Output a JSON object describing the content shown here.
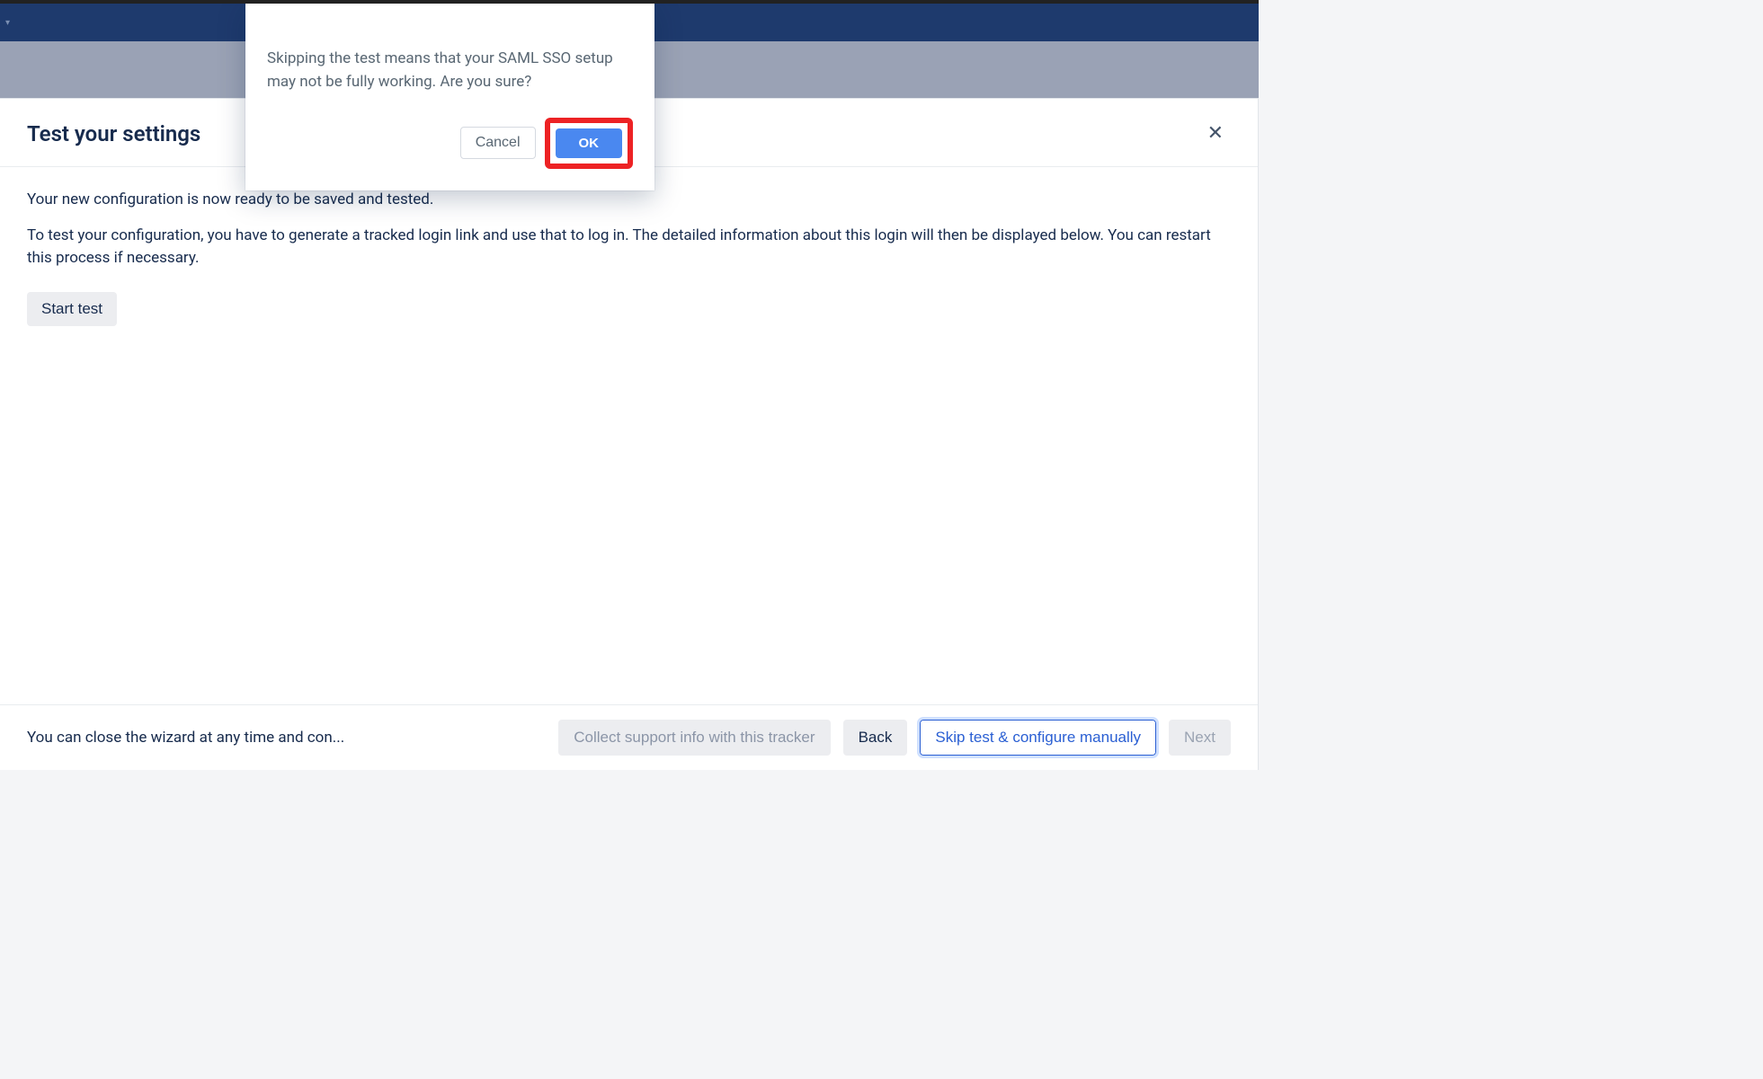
{
  "nav": {
    "chevron_label": "▾"
  },
  "panel": {
    "title": "Test your settings",
    "close_label": "✕",
    "body": {
      "line1": "Your new configuration is now ready to be saved and tested.",
      "line2": "To test your configuration, you have to generate a tracked login link and use that to log in. The detailed information about this login will then be displayed below. You can restart this process if necessary.",
      "start_test_label": "Start test"
    },
    "footer": {
      "hint": "You can close the wizard at any time and con...",
      "collect_support_label": "Collect support info with this tracker",
      "back_label": "Back",
      "skip_label": "Skip test & configure manually",
      "next_label": "Next"
    }
  },
  "modal": {
    "message": "Skipping the test means that your SAML SSO setup may not be fully working. Are you sure?",
    "cancel_label": "Cancel",
    "ok_label": "OK"
  }
}
